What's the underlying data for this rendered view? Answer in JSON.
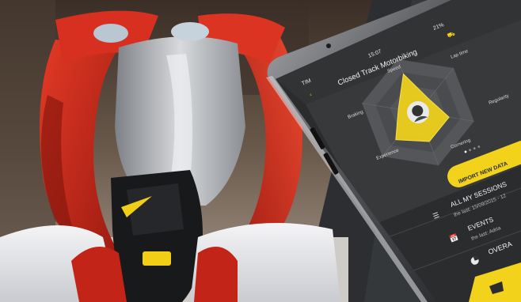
{
  "status_bar": {
    "carrier": "TIM",
    "time": "15:07",
    "battery": "21%"
  },
  "app": {
    "title": "Closed Track Motorbiking",
    "axes": [
      "Speed",
      "Lap time",
      "Regularity",
      "Cornering",
      "Experience",
      "Braking"
    ],
    "axis_levels": [
      0.72,
      0.3,
      0.55,
      0.55,
      0.62,
      0.35
    ],
    "import_button": "IMPORT NEW DATA",
    "menu": [
      {
        "title": "ALL MY SESSIONS",
        "subtitle": "the last: 15/09/2015 - 12",
        "icon": "list-icon"
      },
      {
        "title": "EVENTS",
        "subtitle": "the last: Adria ",
        "icon": "calendar-icon"
      },
      {
        "title": "OVERA",
        "subtitle": "",
        "icon": "pie-chart-icon"
      }
    ]
  },
  "colors": {
    "accent": "#f2d21a",
    "phone_screen": "#2b2c2e",
    "bike_red": "#d42a1c",
    "background": "#2a2c2e"
  }
}
